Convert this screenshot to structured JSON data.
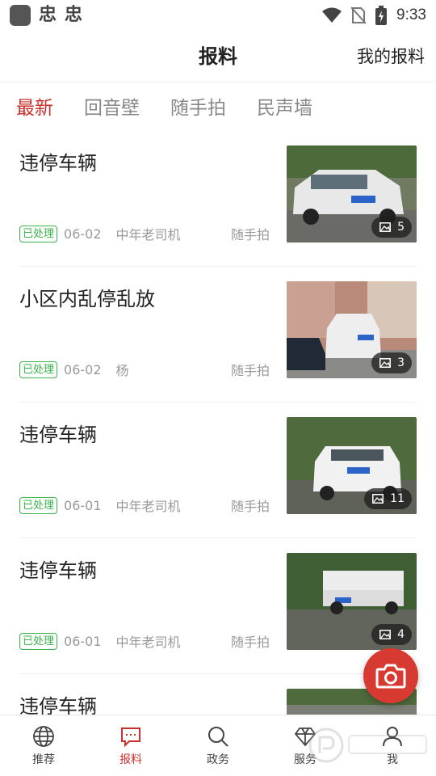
{
  "status_bar": {
    "notification_glyphs": [
      "忠",
      "忠"
    ],
    "time": "9:33",
    "icons": [
      "wifi-icon",
      "no-sim-icon",
      "battery-charging-icon"
    ]
  },
  "header": {
    "title": "报料",
    "my_reports": "我的报料"
  },
  "tabs": [
    {
      "label": "最新",
      "active": true
    },
    {
      "label": "回音壁",
      "active": false
    },
    {
      "label": "随手拍",
      "active": false
    },
    {
      "label": "民声墙",
      "active": false
    }
  ],
  "feed": [
    {
      "title": "违停车辆",
      "badge": "已处理",
      "date": "06-02",
      "user": "中年老司机",
      "category": "随手拍",
      "image_count": "5"
    },
    {
      "title": "小区内乱停乱放",
      "badge": "已处理",
      "date": "06-02",
      "user": "杨",
      "category": "随手拍",
      "image_count": "3"
    },
    {
      "title": "违停车辆",
      "badge": "已处理",
      "date": "06-01",
      "user": "中年老司机",
      "category": "随手拍",
      "image_count": "11"
    },
    {
      "title": "违停车辆",
      "badge": "已处理",
      "date": "06-01",
      "user": "中年老司机",
      "category": "随手拍",
      "image_count": "4"
    },
    {
      "title": "违停车辆",
      "badge": "",
      "date": "",
      "user": "",
      "category": "",
      "image_count": ""
    }
  ],
  "fab": {
    "icon": "camera-icon",
    "color": "#d63a30"
  },
  "bottom_nav": [
    {
      "label": "推荐",
      "icon": "globe-icon",
      "active": false
    },
    {
      "label": "报料",
      "icon": "chat-report-icon",
      "active": true
    },
    {
      "label": "政务",
      "icon": "search-icon",
      "active": false
    },
    {
      "label": "服务",
      "icon": "diamond-icon",
      "active": false
    },
    {
      "label": "我",
      "icon": "person-icon",
      "active": false
    }
  ],
  "colors": {
    "accent": "#c9302c",
    "badge_green": "#39b54a"
  }
}
